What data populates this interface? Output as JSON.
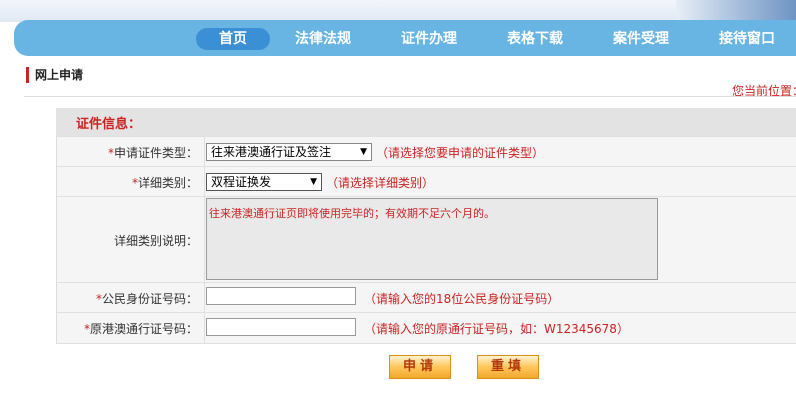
{
  "nav": {
    "items": [
      {
        "label": "首页",
        "active": true
      },
      {
        "label": "法律法规"
      },
      {
        "label": "证件办理"
      },
      {
        "label": "表格下载"
      },
      {
        "label": "案件受理"
      },
      {
        "label": "接待窗口"
      }
    ]
  },
  "section_title": "网上申请",
  "location": "您当前位置：",
  "panel_title": "证件信息：",
  "form": {
    "required_mark": "*",
    "cert_type": {
      "label": "申请证件类型：",
      "value": "往来港澳通行证及签注",
      "hint": "（请选择您要申请的证件类型）"
    },
    "detail_type": {
      "label": "详细类别：",
      "value": "双程证换发",
      "hint": "（请选择详细类别）"
    },
    "detail_desc": {
      "label": "详细类别说明：",
      "text": "往来港澳通行证页即将使用完毕的；有效期不足六个月的。"
    },
    "id_number": {
      "label": "公民身份证号码：",
      "value": "",
      "hint": "（请输入您的18位公民身份证号码）"
    },
    "permit_number": {
      "label": "原港澳通行证号码：",
      "value": "",
      "hint": "（请输入您的原通行证号码，如：W12345678）"
    }
  },
  "buttons": {
    "apply": "申请",
    "reset": "重填"
  },
  "colors": {
    "nav_bg": "#68b4e2",
    "nav_active": "#3b8fd4",
    "accent_red": "#cc2222",
    "button_orange": "#ffc75a"
  }
}
